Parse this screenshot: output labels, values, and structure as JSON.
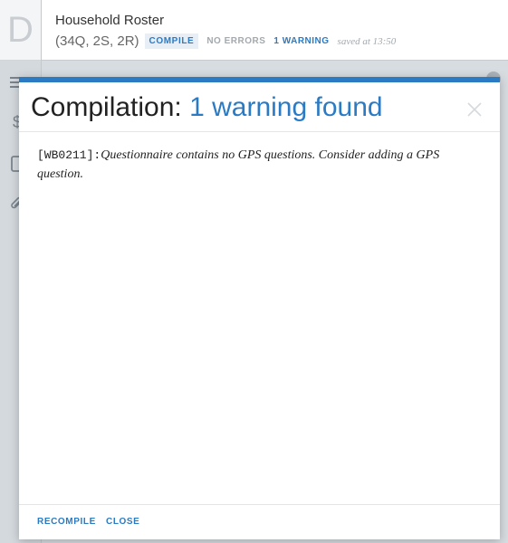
{
  "app": {
    "doc_letter": "D",
    "questionnaire_title": "Household Roster",
    "counts": "(34Q, 2S, 2R)",
    "compile_label": "COMPILE",
    "errors_label": "NO ERRORS",
    "warnings_label": "1 WARNING",
    "saved_label": "saved at 13:50"
  },
  "modal": {
    "title_prefix": "Compilation:",
    "title_accent": "1 warning found",
    "messages": [
      {
        "code": "[WB0211]",
        "separator": ":",
        "text": "Questionnaire contains no GPS questions. Consider adding a GPS question."
      }
    ],
    "recompile_label": "RECOMPILE",
    "close_label": "CLOSE"
  },
  "colors": {
    "accent": "#2a7bc4",
    "muted": "#a3a9ae",
    "overlay": "#d7dce1"
  },
  "icons": {
    "rail": [
      "menu-icon",
      "dollar-icon",
      "document-icon",
      "attachment-icon"
    ],
    "close": "close-icon"
  }
}
